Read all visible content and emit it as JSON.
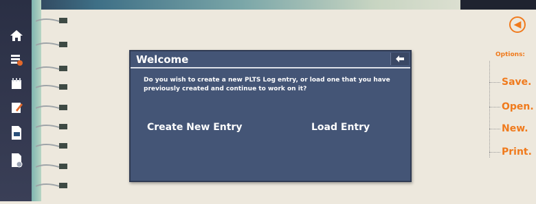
{
  "sidebar": {
    "icons": [
      "home-icon",
      "log-list-icon",
      "diary-icon",
      "edit-page-icon",
      "export-document-icon",
      "settings-document-icon"
    ]
  },
  "header": {
    "back_icon": "arrow-left-circle-icon"
  },
  "options": {
    "title": "Options:",
    "items": [
      {
        "label": "Save."
      },
      {
        "label": "Open."
      },
      {
        "label": "New."
      },
      {
        "label": "Print."
      }
    ]
  },
  "dialog": {
    "title": "Welcome",
    "close_icon": "arrow-left-icon",
    "message": "Do you wish to create a new PLTS Log entry, or load one that you have previously created and continue to work on it?",
    "create_label": "Create New Entry",
    "load_label": "Load Entry"
  },
  "colors": {
    "accent": "#f07a1c",
    "dialog_bg": "#445576",
    "sidebar_bg": "#2a2f44",
    "page_bg": "#ede8dd"
  }
}
